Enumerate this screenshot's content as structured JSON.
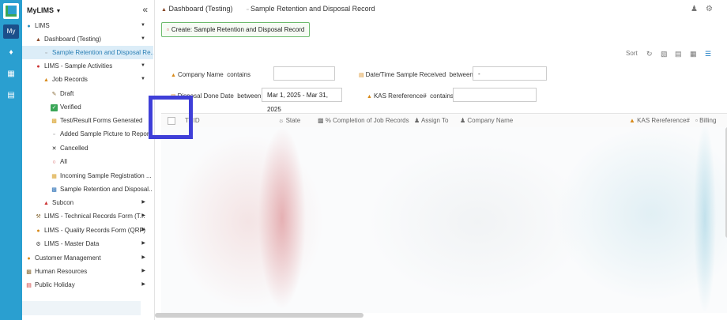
{
  "rail": {
    "my_label": "My"
  },
  "sidebar": {
    "title": "MyLIMS",
    "items": [
      {
        "label": "LIMS"
      },
      {
        "label": "Dashboard (Testing)"
      },
      {
        "label": "Sample Retention and Disposal Re..."
      },
      {
        "label": "LIMS - Sample Activities"
      },
      {
        "label": "Job Records"
      },
      {
        "label": "Draft"
      },
      {
        "label": "Verified"
      },
      {
        "label": "Test/Result Forms Generated"
      },
      {
        "label": "Added Sample Picture to Repor..."
      },
      {
        "label": "Cancelled"
      },
      {
        "label": "All"
      },
      {
        "label": "Incoming Sample Registration ..."
      },
      {
        "label": "Sample Retention and Disposal..."
      },
      {
        "label": "Subcon"
      },
      {
        "label": "LIMS - Technical Records Form (T..."
      },
      {
        "label": "LIMS - Quality Records Form (QRF)"
      },
      {
        "label": "LIMS - Master Data"
      },
      {
        "label": "Customer Management"
      },
      {
        "label": "Human Resources"
      },
      {
        "label": "Public Holiday"
      }
    ]
  },
  "breadcrumb": {
    "parent": "Dashboard (Testing)",
    "current": "Sample Retention and Disposal Record"
  },
  "toolbar": {
    "create_label": "Create: Sample Retention and Disposal Record",
    "sort_label": "Sort"
  },
  "filters": {
    "company_name": {
      "label": "Company Name",
      "operator": "contains",
      "value": ""
    },
    "date_received": {
      "label": "Date/Time Sample Received",
      "operator": "between",
      "value": "-"
    },
    "disposal_date": {
      "label": "Disposal Done Date",
      "operator": "between",
      "value": "Mar 1, 2025 - Mar 31, 2025"
    },
    "kas_ref": {
      "label": "KAS Rereference#",
      "operator": "contains",
      "value": ""
    }
  },
  "grid": {
    "columns": [
      "TRID",
      "State",
      "% Completion of Job Records",
      "Assign To",
      "Company Name",
      "KAS Rereference#",
      "Billing"
    ]
  },
  "colors": {
    "rail": "#2a9fd0",
    "active_bg": "#dcedf8",
    "highlight": "#3f3fd8",
    "create_border": "#6dbb6d"
  }
}
